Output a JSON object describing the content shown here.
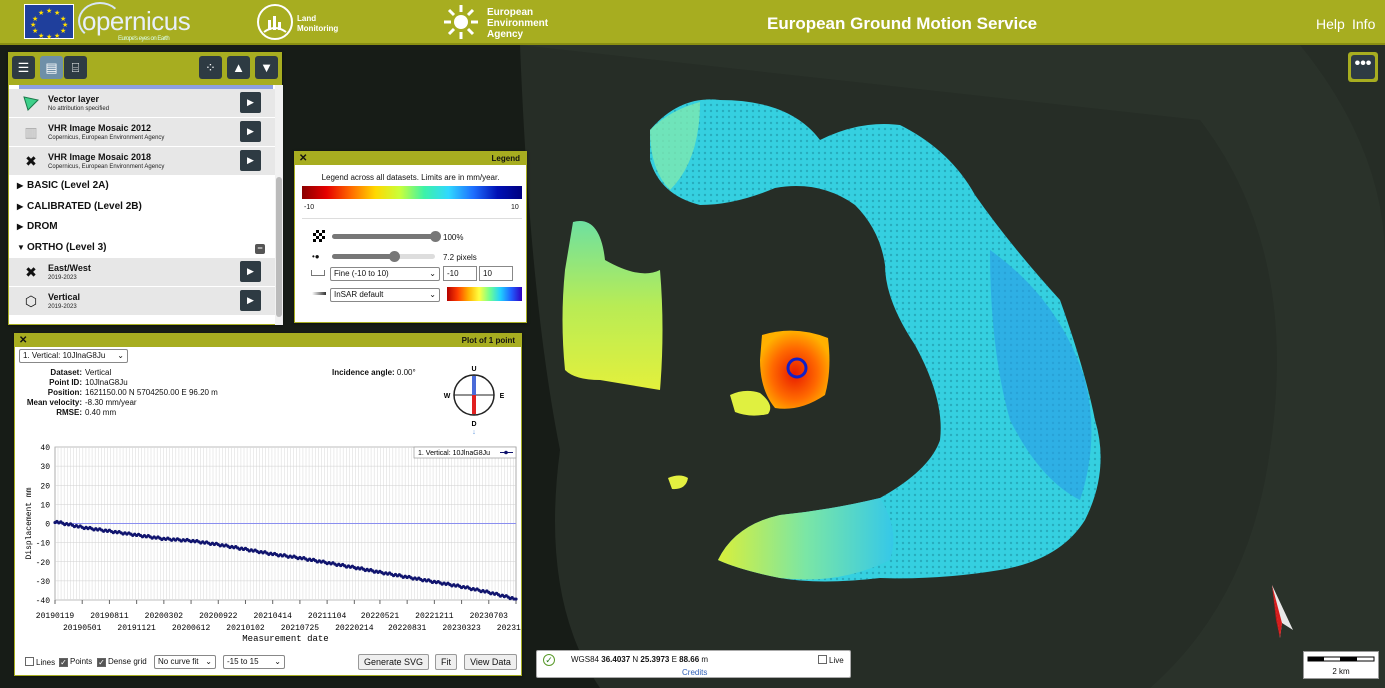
{
  "header": {
    "copernicus": "opernicus",
    "copernicus_tagline": "Europe's eyes on Earth",
    "land_monitoring": [
      "Land",
      "Monitoring"
    ],
    "eea": [
      "European",
      "Environment",
      "Agency"
    ],
    "title": "European Ground Motion Service",
    "help": "Help",
    "info": "Info"
  },
  "layers": {
    "items": [
      {
        "name": "Vector layer",
        "attribution": "No attribution specified",
        "icon": "vector-triangle-icon"
      },
      {
        "name": "VHR Image Mosaic 2012",
        "attribution": "Copernicus, European Environment Agency",
        "icon": "map-icon"
      },
      {
        "name": "VHR Image Mosaic 2018",
        "attribution": "Copernicus, European Environment Agency",
        "icon": "cross-arrows-icon"
      }
    ],
    "groups": [
      "BASIC (Level 2A)",
      "CALIBRATED (Level 2B)",
      "DROM",
      "ORTHO (Level 3)"
    ],
    "ortho_items": [
      {
        "name": "East/West",
        "attribution": "2019-2023",
        "icon": "east-west-arrows-icon"
      },
      {
        "name": "Vertical",
        "attribution": "2019-2023",
        "icon": "cube-icon"
      }
    ]
  },
  "legend": {
    "title": "Legend",
    "caption": "Legend across all datasets. Limits are in mm/year.",
    "min_label": "-10",
    "max_label": "10",
    "opacity_label": "100%",
    "opacity_value": 1.0,
    "size_label": "7.2 pixels",
    "size_value": 0.6,
    "range_select": "Fine (-10 to 10)",
    "range_min": "-10",
    "range_max": "10",
    "colormap_select": "InSAR default"
  },
  "plot": {
    "title": "Plot of 1 point",
    "point_select": "1. Vertical: 10JlnaG8Ju",
    "dataset_label": "Dataset:",
    "dataset": "Vertical",
    "point_id_label": "Point ID:",
    "point_id": "10JlnaG8Ju",
    "position_label": "Position:",
    "position": "1621150.00 N 5704250.00 E 96.20 m",
    "velocity_label": "Mean velocity:",
    "velocity": "-8.30 mm/year",
    "rmse_label": "RMSE:",
    "rmse": "0.40 mm",
    "incidence_label": "Incidence angle:",
    "incidence": "0.00°",
    "compass": {
      "u": "U",
      "d": "D",
      "w": "W",
      "e": "E"
    },
    "lines_label": "Lines",
    "lines_checked": false,
    "points_label": "Points",
    "points_checked": true,
    "dense_label": "Dense grid",
    "dense_checked": true,
    "curve_fit": "No curve fit",
    "yrange": "-15 to 15",
    "generate_svg": "Generate SVG",
    "fit": "Fit",
    "view_data": "View Data"
  },
  "chart_data": {
    "type": "scatter",
    "xlabel": "Measurement date",
    "ylabel": "Displacement mm",
    "ylim": [
      -40,
      40
    ],
    "xlim": [
      "2019-01-19",
      "2023-10-13"
    ],
    "yticks": [
      "40",
      "30",
      "20",
      "10",
      "0",
      "-10",
      "-20",
      "-30",
      "-40"
    ],
    "xticks_top": [
      "20190119",
      "20190811",
      "20200302",
      "20200922",
      "20210414",
      "20211104",
      "20220521",
      "20221211",
      "20230703"
    ],
    "xticks_bottom": [
      "20190501",
      "20191121",
      "20200612",
      "20210102",
      "20210725",
      "20220214",
      "20220831",
      "20230323",
      "20231013"
    ],
    "grid": true,
    "legend_position": "top-right",
    "series": [
      {
        "name": "1. Vertical: 10JlnaG8Ju",
        "color": "#10146e",
        "x": [
          "2019-01-19",
          "2019-05-01",
          "2019-08-11",
          "2019-11-21",
          "2020-03-02",
          "2020-06-12",
          "2020-09-22",
          "2021-01-02",
          "2021-04-14",
          "2021-07-25",
          "2021-11-04",
          "2022-02-14",
          "2022-05-21",
          "2022-08-31",
          "2022-12-11",
          "2023-03-23",
          "2023-07-03",
          "2023-10-13"
        ],
        "values": [
          1,
          -2,
          -4,
          -6,
          -8,
          -9,
          -11,
          -13.5,
          -16,
          -18,
          -20.5,
          -23,
          -25.5,
          -28,
          -30.5,
          -33,
          -36,
          -39.5
        ]
      }
    ],
    "zero_line_color": "#8a8ef0"
  },
  "status": {
    "crs": "WGS84",
    "lat": "36.4037",
    "lat_dir": "N",
    "lon": "25.3973",
    "lon_dir": "E",
    "height": "88.66",
    "unit": "m",
    "live_label": "Live",
    "credits": "Credits"
  },
  "scale": {
    "label": "2 km"
  },
  "colors": {
    "brand": "#a7ad20",
    "button": "#2e3b43"
  }
}
